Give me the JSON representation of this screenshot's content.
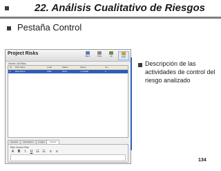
{
  "slide": {
    "title": "22. Análisis Cualitativo de Riesgos",
    "bullet_heading": "Pestaña Control",
    "description": "Descripción de las actividades de control del riesgo analizado",
    "page_number": "134"
  },
  "window": {
    "title": "Project Risks",
    "toolbar": [
      "Back",
      "Print",
      "All",
      "Help"
    ],
    "filter": "Viewer: All Risks",
    "columns": [
      "ID",
      "Risk Name",
      "Code",
      "Status",
      "Owner",
      "Lev"
    ],
    "selected_row": [
      "1",
      "Risk Plan1",
      "F001",
      "Open",
      "J. Carbal",
      "2"
    ],
    "tabs": [
      "General",
      "Description",
      "Impact",
      "Control"
    ],
    "active_tab": "Control",
    "detail_label": "Risk Control Plan",
    "format_buttons": [
      "A",
      "B",
      "I",
      "U",
      "☷",
      "☷",
      "≡",
      "≡"
    ]
  },
  "colors": {
    "accent_blue": "#2b5fbf",
    "selected_row": "#2f5cb5",
    "title_rule": "#7f7f7f"
  }
}
